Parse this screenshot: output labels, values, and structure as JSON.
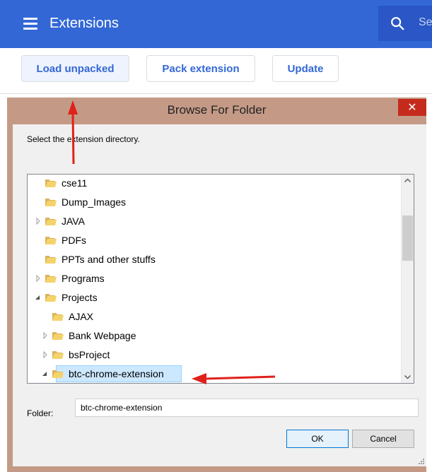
{
  "header": {
    "title": "Extensions",
    "search_placeholder": "Se",
    "bg_color": "#3367d6"
  },
  "toolbar": {
    "load_unpacked": "Load unpacked",
    "pack_extension": "Pack extension",
    "update": "Update"
  },
  "dialog": {
    "title": "Browse For Folder",
    "close_symbol": "✕",
    "instruction": "Select the extension directory.",
    "folder_label": "Folder:",
    "folder_value": "btc-chrome-extension",
    "ok_label": "OK",
    "cancel_label": "Cancel",
    "tree": [
      {
        "label": "cse11",
        "expander": "none",
        "selected": false
      },
      {
        "label": "Dump_Images",
        "expander": "none",
        "selected": false
      },
      {
        "label": "JAVA",
        "expander": "collapsed",
        "selected": false
      },
      {
        "label": "PDFs",
        "expander": "none",
        "selected": false
      },
      {
        "label": "PPTs and other stuffs",
        "expander": "none",
        "selected": false
      },
      {
        "label": "Programs",
        "expander": "collapsed",
        "selected": false
      },
      {
        "label": "Projects",
        "expander": "expanded",
        "selected": false
      },
      {
        "label": "AJAX",
        "expander": "none",
        "selected": false
      },
      {
        "label": "Bank Webpage",
        "expander": "collapsed",
        "selected": false
      },
      {
        "label": "bsProject",
        "expander": "collapsed",
        "selected": false
      },
      {
        "label": "btc-chrome-extension",
        "expander": "expanded",
        "selected": true
      }
    ]
  },
  "icons": [
    "hamburger-icon",
    "search-icon",
    "folder-icon",
    "close-icon",
    "arrow-annotation"
  ],
  "colors": {
    "accent": "#3367d6",
    "dialog_frame": "#c49a86",
    "close_red": "#c42b1c",
    "selection": "#cce8ff",
    "annotation_red": "#e0201b"
  }
}
